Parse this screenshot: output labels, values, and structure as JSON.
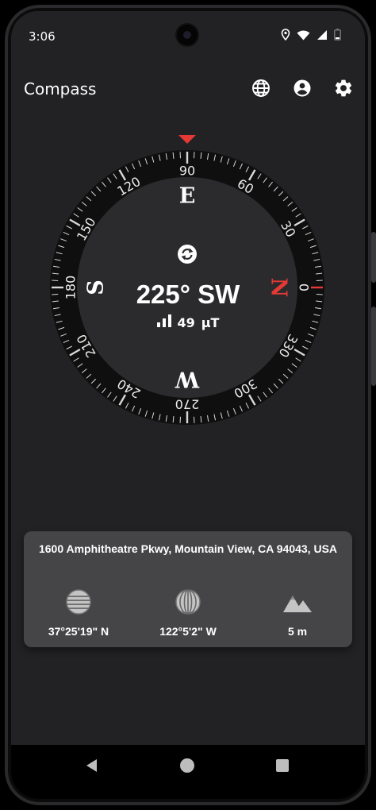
{
  "status_bar": {
    "time": "3:06"
  },
  "app_bar": {
    "title": "Compass",
    "icons": [
      "globe-icon",
      "account-icon",
      "settings-icon"
    ]
  },
  "compass": {
    "heading_text": "225° SW",
    "field_value": "49",
    "field_unit": "µT",
    "heading_degrees": 225,
    "cardinals": {
      "n": "N",
      "e": "E",
      "s": "S",
      "w": "W"
    },
    "degree_labels": [
      "0",
      "30",
      "60",
      "90",
      "120",
      "150",
      "180",
      "210",
      "240",
      "270",
      "300",
      "330"
    ],
    "accent_color": "#e53935"
  },
  "location": {
    "address": "1600 Amphitheatre Pkwy, Mountain View, CA 94043, USA",
    "latitude": "37°25'19\" N",
    "longitude": "122°5'2\" W",
    "altitude": "5 m"
  }
}
